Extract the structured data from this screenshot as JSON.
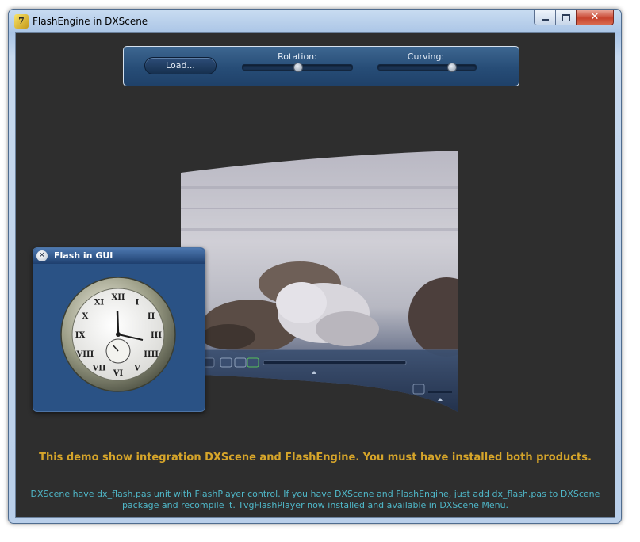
{
  "window": {
    "title": "FlashEngine in DXScene",
    "app_icon_glyph": "7"
  },
  "caption_buttons": {
    "minimize": "minimize-icon",
    "maximize": "maximize-icon",
    "close": "close-icon",
    "close_glyph": "✕"
  },
  "toolbar": {
    "load_label": "Load...",
    "rotation_label": "Rotation:",
    "rotation_value": 0.5,
    "curving_label": "Curving:",
    "curving_value": 0.75
  },
  "gui_panel": {
    "title": "Flash in GUI",
    "close_glyph": "✕"
  },
  "clock": {
    "numerals": [
      "XII",
      "I",
      "II",
      "III",
      "IIII",
      "V",
      "VI",
      "VII",
      "VIII",
      "IX",
      "X",
      "XI"
    ]
  },
  "texts": {
    "main": "This demo show integration DXScene and FlashEngine. You must have installed both products.",
    "info": "DXScene have dx_flash.pas unit with FlashPlayer control. If you have DXScene and FlashEngine, just add dx_flash.pas to DXScene package and recompile it. TvgFlashPlayer now installed and available in DXScene Menu."
  },
  "colors": {
    "client_bg": "#2e2e2e",
    "panel_blue": "#2a5285",
    "main_text": "#d6a52a",
    "info_text": "#4fb7c8"
  }
}
